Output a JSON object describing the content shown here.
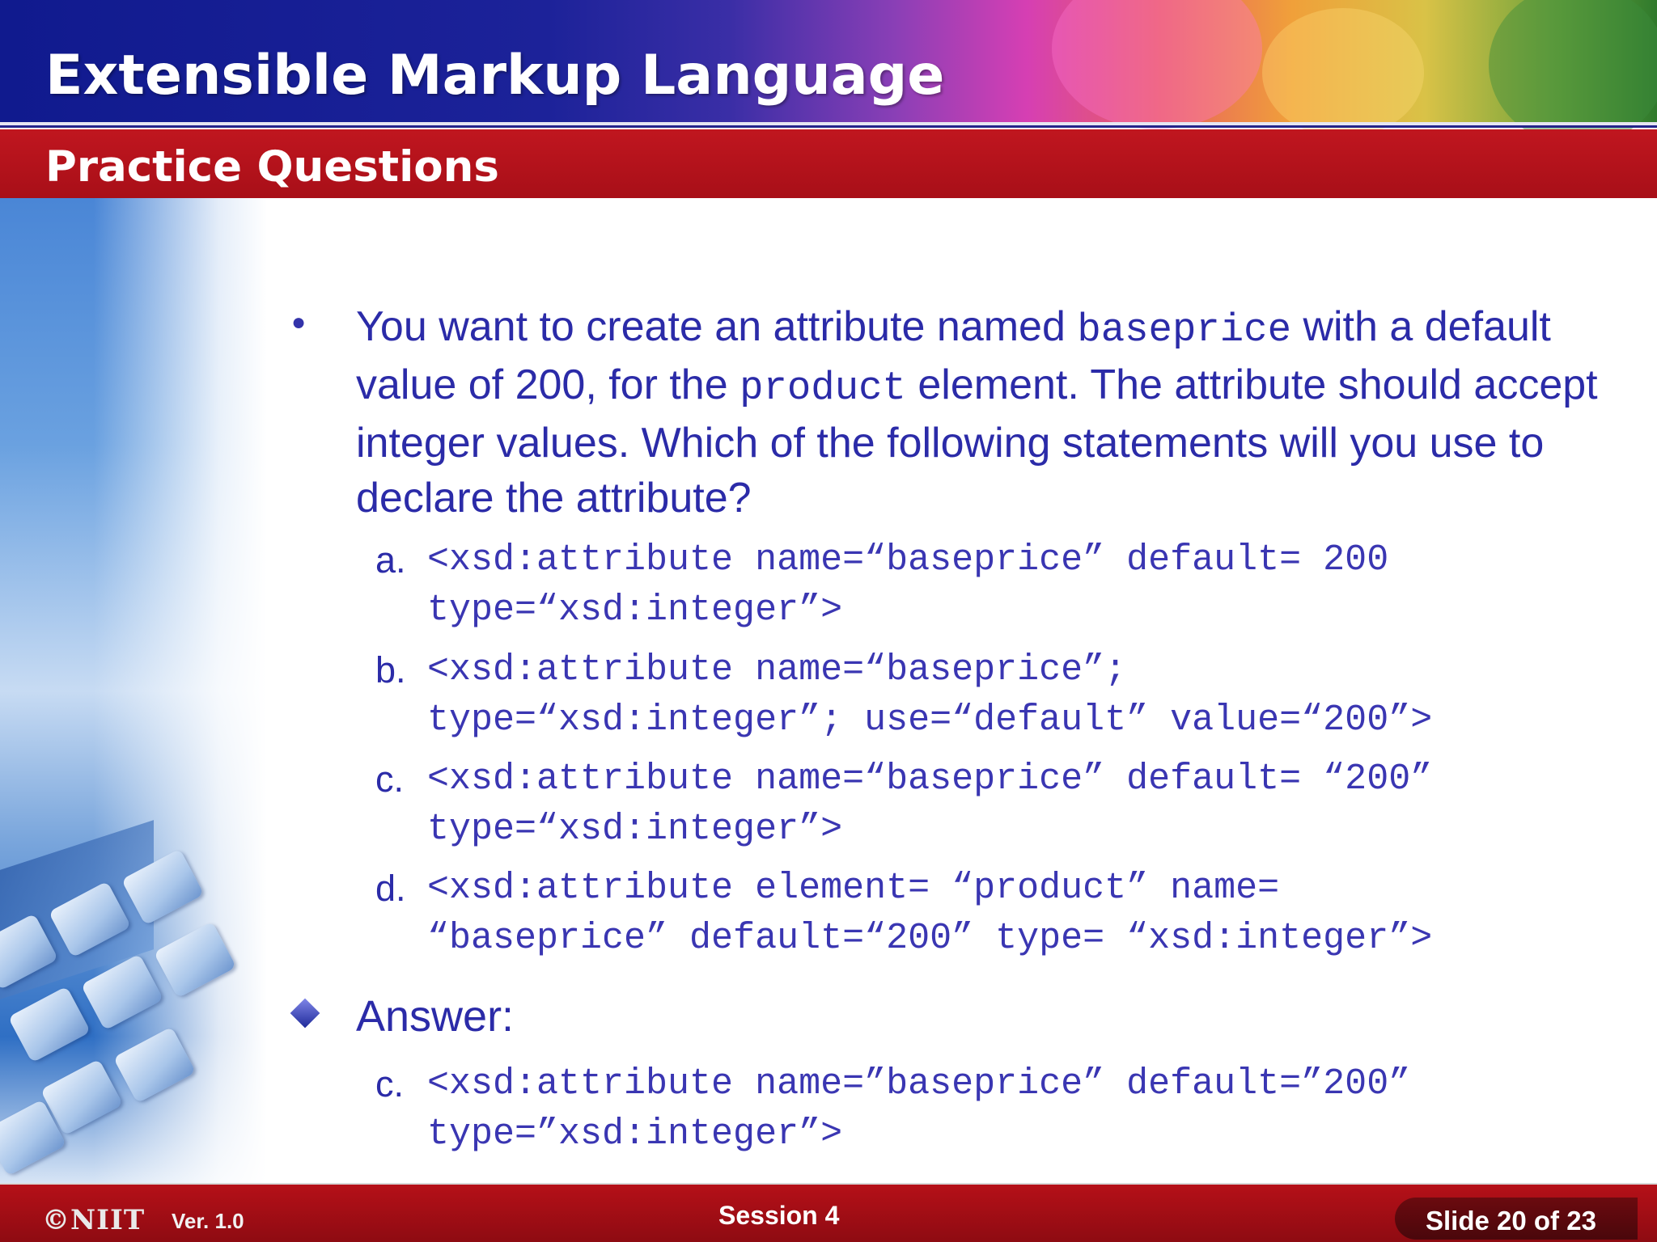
{
  "header": {
    "title": "Extensible Markup Language",
    "subtitle": "Practice Questions"
  },
  "question": {
    "part1": "You want to create an attribute named ",
    "code1": "baseprice",
    "part2": " with a default value of 200, for the ",
    "code2": "product",
    "part3": " element. The attribute should accept integer values. Which of the following statements will you use to declare the attribute?"
  },
  "options": [
    {
      "letter": "a.",
      "code": "<xsd:attribute name=“baseprice” default= 200\ntype=“xsd:integer”>"
    },
    {
      "letter": "b.",
      "code": "<xsd:attribute name=“baseprice”;\ntype=“xsd:integer”; use=“default” value=“200”>"
    },
    {
      "letter": "c.",
      "code": "<xsd:attribute name=“baseprice” default= “200”\ntype=“xsd:integer”>"
    },
    {
      "letter": "d.",
      "code": "<xsd:attribute element= “product” name=\n“baseprice” default=“200” type= “xsd:integer”>"
    }
  ],
  "answer": {
    "label": "Answer:",
    "letter": "c.",
    "code": "<xsd:attribute name=”baseprice” default=”200”\ntype=”xsd:integer”>"
  },
  "footer": {
    "logo": "©NIIT",
    "version": "Ver.  1.0",
    "session": "Session 4",
    "slide": "Slide 20 of  23"
  },
  "colors": {
    "header_blue": "#101a8e",
    "subbar_red": "#c0161f",
    "text_blue": "#2b2ba8",
    "footer_red": "#a80f18"
  }
}
